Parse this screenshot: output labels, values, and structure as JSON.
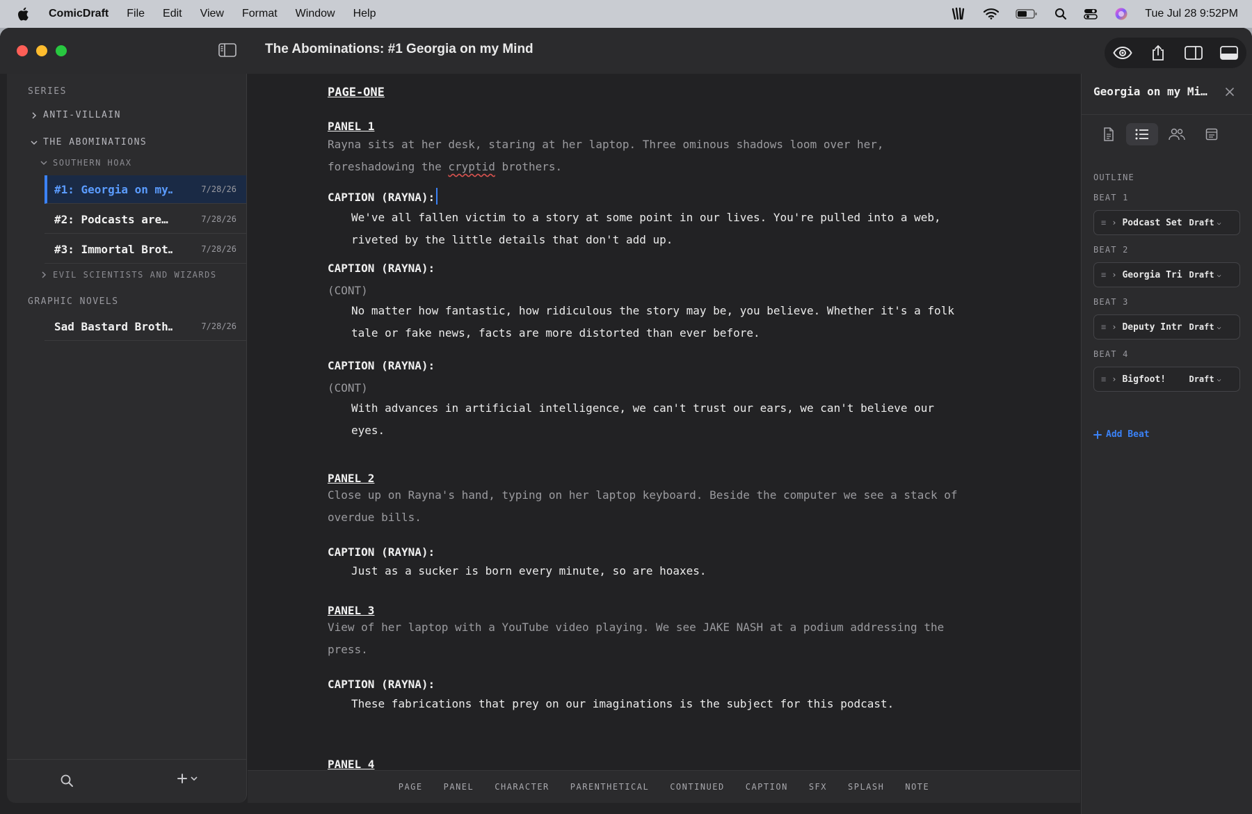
{
  "menubar": {
    "app_name": "ComicDraft",
    "items": [
      "File",
      "Edit",
      "View",
      "Format",
      "Window",
      "Help"
    ],
    "clock": "Tue Jul 28  9:52PM"
  },
  "window": {
    "title": "The Abominations: #1 Georgia on my Mind"
  },
  "sidebar": {
    "series_label": "SERIES",
    "groups": [
      {
        "label": "ANTI-VILLAIN",
        "expanded": false
      },
      {
        "label": "THE ABOMINATIONS",
        "expanded": true
      }
    ],
    "subgroups": [
      {
        "label": "SOUTHERN HOAX",
        "expanded": true
      },
      {
        "label": "EVIL SCIENTISTS AND WIZARDS",
        "expanded": false
      }
    ],
    "issues": [
      {
        "name": "#1: Georgia on my…",
        "date": "7/28/26",
        "selected": true
      },
      {
        "name": "#2: Podcasts are…",
        "date": "7/28/26"
      },
      {
        "name": "#3: Immortal Brot…",
        "date": "7/28/26"
      }
    ],
    "graphic_novels_label": "GRAPHIC NOVELS",
    "graphic_novels": [
      {
        "name": "Sad Bastard Broth…",
        "date": "7/28/26"
      }
    ]
  },
  "script": {
    "page_heading": "PAGE-ONE",
    "panel1": {
      "heading": "PANEL 1",
      "action_line1": "Rayna sits at her desk, staring at her laptop. Three ominous shadows loom over her,",
      "action_line2_pre": "foreshadowing the ",
      "action_line2_misspelled": "cryptid",
      "action_line2_post": " brothers.",
      "cap1_cue": "CAPTION (RAYNA):",
      "cap1_line1": "We've all fallen victim to a story at some point in our lives. You're pulled into a web,",
      "cap1_line2": "riveted by the little details that don't add up.",
      "cap2_cue": "CAPTION (RAYNA):",
      "cap2_paren": "(CONT)",
      "cap2_line1": "No matter how fantastic, how ridiculous the story may be, you believe. Whether it's a folk",
      "cap2_line2": "tale or fake news, facts are more distorted than ever before.",
      "cap3_cue": "CAPTION (RAYNA):",
      "cap3_paren": "(CONT)",
      "cap3_line1": "With advances in artificial intelligence, we can't trust our ears, we can't believe our",
      "cap3_line2": "eyes."
    },
    "panel2": {
      "heading": "PANEL 2",
      "action_line1": "Close up on Rayna's hand, typing on her laptop keyboard. Beside the computer we see a stack of",
      "action_line2": "overdue bills.",
      "cap_cue": "CAPTION (RAYNA):",
      "cap_line1": "Just as a sucker is born every minute, so are hoaxes."
    },
    "panel3": {
      "heading": "PANEL 3",
      "action_line1": "View of her laptop with a YouTube video playing. We see JAKE NASH at a podium addressing the",
      "action_line2": "press.",
      "cap_cue": "CAPTION (RAYNA):",
      "cap_line1": "These fabrications that prey on our imaginations is the subject for this podcast."
    },
    "panel4": {
      "heading": "PANEL 4"
    }
  },
  "elements_bar": [
    "PAGE",
    "PANEL",
    "CHARACTER",
    "PARENTHETICAL",
    "CONTINUED",
    "CAPTION",
    "SFX",
    "SPLASH",
    "NOTE"
  ],
  "right_panel": {
    "title": "Georgia on my Mi…",
    "outline_label": "OUTLINE",
    "beats": [
      {
        "label": "BEAT 1",
        "title": "Podcast Set",
        "status": "Draft"
      },
      {
        "label": "BEAT 2",
        "title": "Georgia Tri",
        "status": "Draft"
      },
      {
        "label": "BEAT 3",
        "title": "Deputy Intr",
        "status": "Draft"
      },
      {
        "label": "BEAT 4",
        "title": "Bigfoot!",
        "status": "Draft"
      }
    ],
    "add_beat": "Add Beat"
  },
  "colors": {
    "accent": "#3b82f6",
    "background": "#222224",
    "sidebar": "#2c2c2e"
  }
}
